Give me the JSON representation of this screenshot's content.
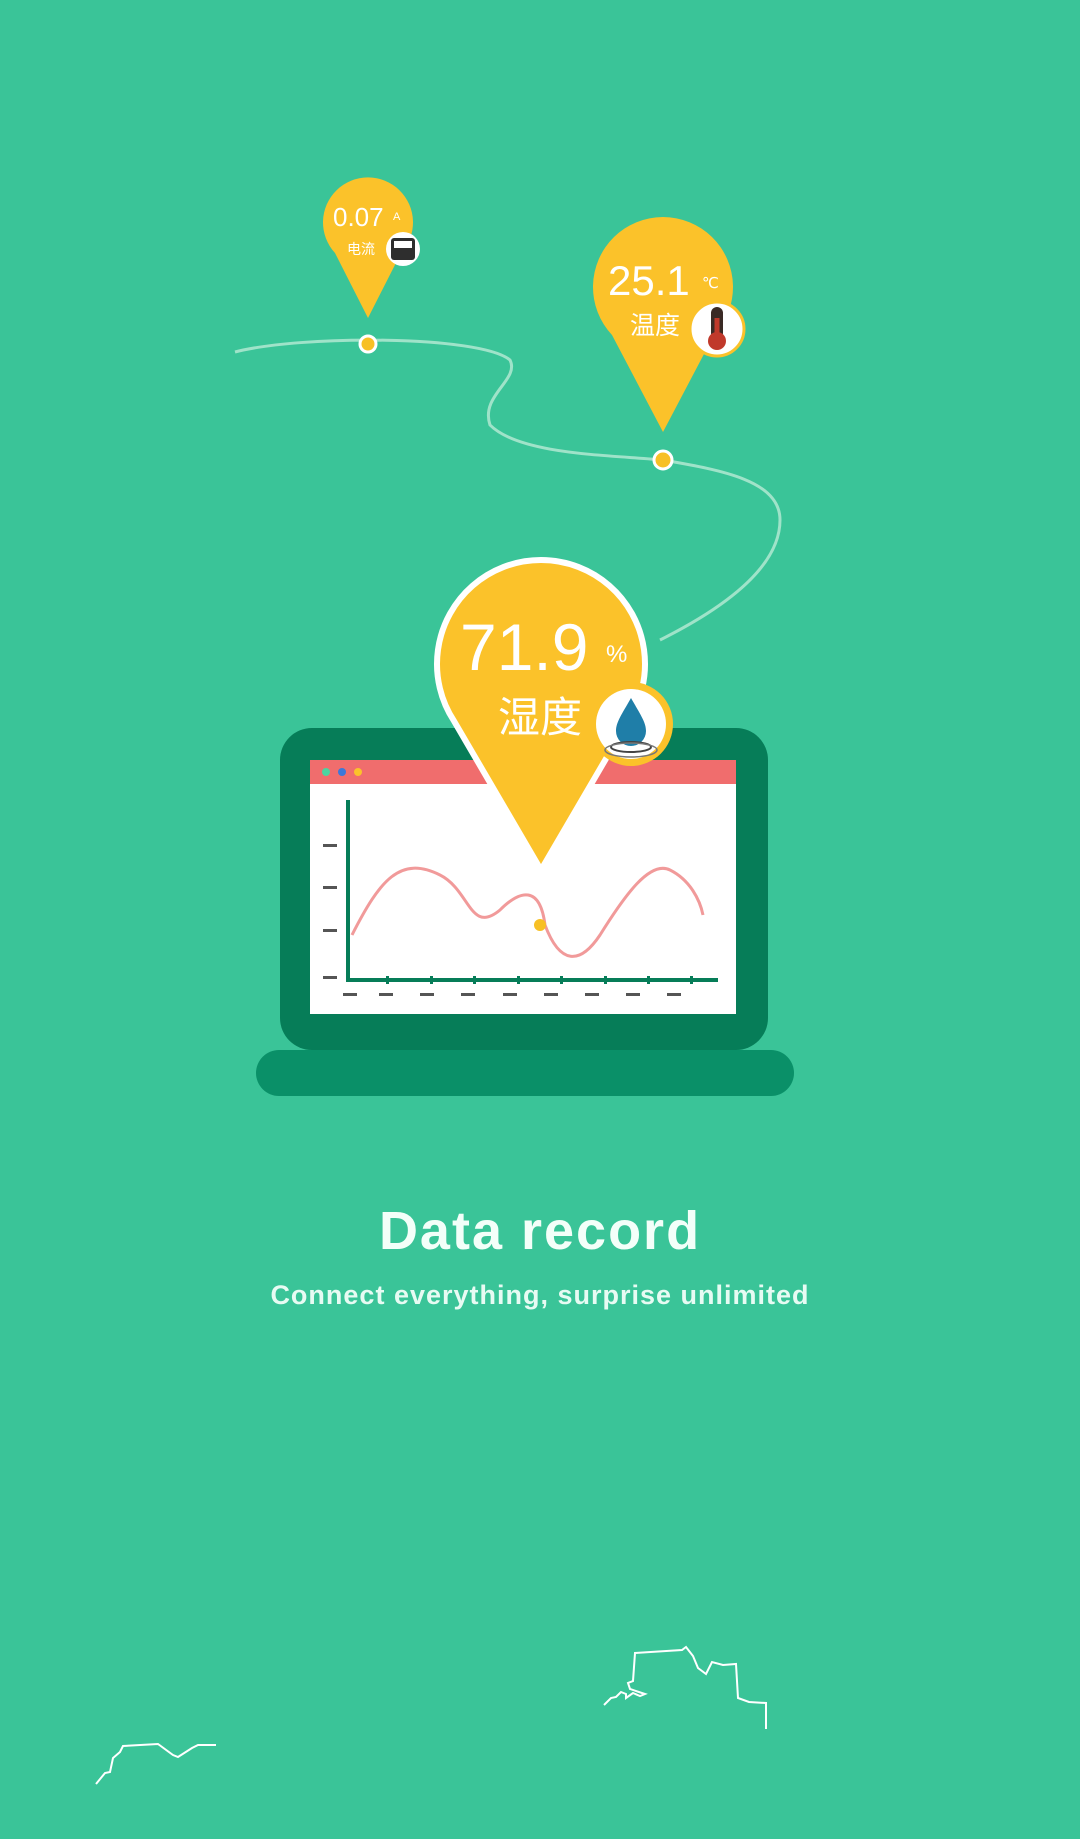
{
  "colors": {
    "background": "#3ac498",
    "pin": "#fbc22a",
    "laptop_frame": "#067d58",
    "laptop_base": "#0a9068",
    "screen_bar": "#f06d6d",
    "curve": "#f19a9a",
    "dot": "#f7c025"
  },
  "icons": [
    "ammeter-icon",
    "thermometer-icon",
    "water-drop-icon"
  ],
  "pins": {
    "current": {
      "value": "0.07",
      "unit": "A",
      "label": "电流"
    },
    "temperature": {
      "value": "25.1",
      "unit": "℃",
      "label": "温度"
    },
    "humidity": {
      "value": "71.9",
      "unit": "%",
      "label": "湿度"
    }
  },
  "onboarding": {
    "title": "Data record",
    "subtitle": "Connect everything, surprise unlimited"
  }
}
